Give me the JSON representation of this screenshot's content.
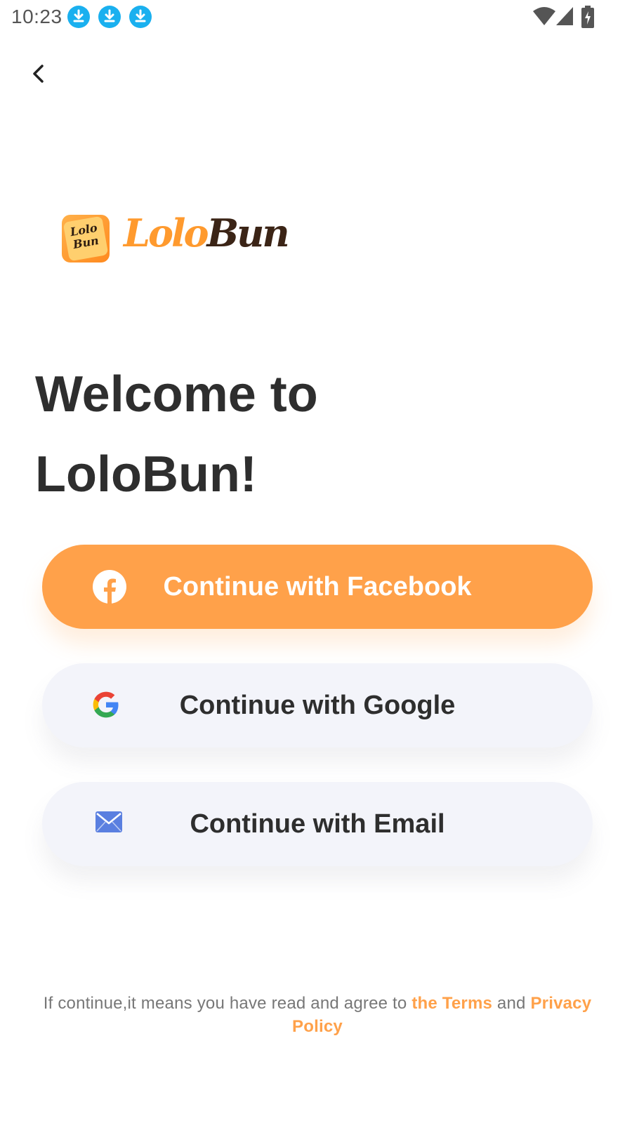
{
  "status_bar": {
    "time": "10:23",
    "notification_icons": [
      "download-icon",
      "download-icon",
      "download-icon"
    ],
    "right_icons": [
      "wifi-icon",
      "signal-icon",
      "battery-charging-icon"
    ],
    "download_color": "#1ab0ef"
  },
  "nav": {
    "back_icon": "chevron-left-icon"
  },
  "logo": {
    "badge_line1": "Lolo",
    "badge_line2": "Bun",
    "word_part1": "Lolo",
    "word_part2": "Bun"
  },
  "welcome": {
    "line1": "Welcome to",
    "line2": "LoloBun!"
  },
  "buttons": {
    "facebook": {
      "label": "Continue with Facebook",
      "icon": "facebook-icon"
    },
    "google": {
      "label": "Continue with Google",
      "icon": "google-icon"
    },
    "email": {
      "label": "Continue with Email",
      "icon": "mail-icon"
    }
  },
  "terms": {
    "prefix": "If continue,it means you have read and agree to ",
    "terms_link": "the Terms",
    "joiner": " and ",
    "privacy_link": "Privacy Policy"
  },
  "colors": {
    "accent": "#ffa14a",
    "text_dark": "#2e2e2e",
    "button_light": "#f3f4fa",
    "email_icon": "#5a7fe0"
  }
}
